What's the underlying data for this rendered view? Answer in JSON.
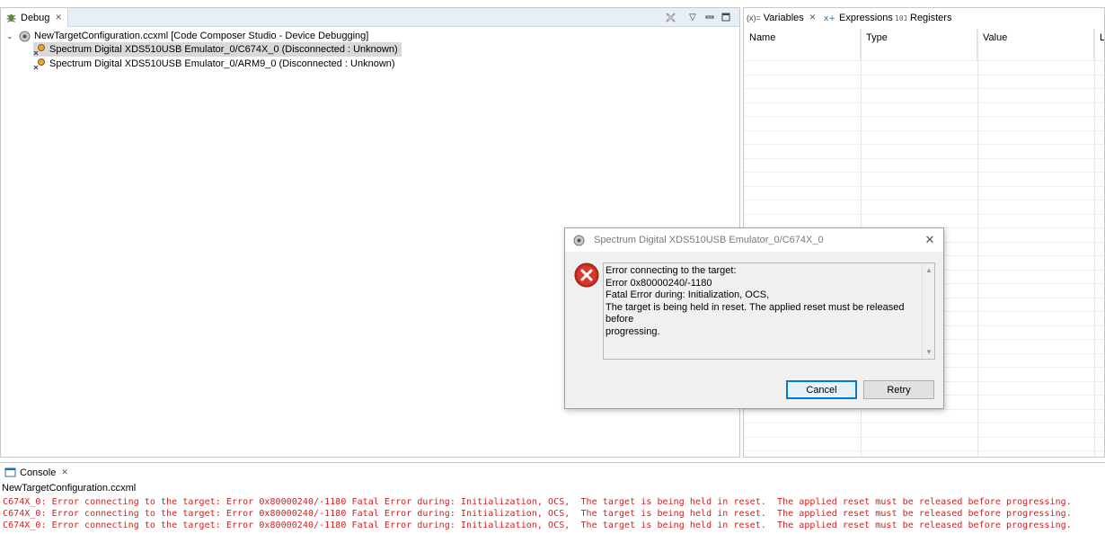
{
  "debug_view": {
    "tab_label": "Debug",
    "tree": {
      "root": "NewTargetConfiguration.ccxml [Code Composer Studio - Device Debugging]",
      "children": [
        "Spectrum Digital XDS510USB Emulator_0/C674X_0 (Disconnected : Unknown)",
        "Spectrum Digital XDS510USB Emulator_0/ARM9_0 (Disconnected : Unknown)"
      ]
    }
  },
  "vars_view": {
    "tabs": [
      {
        "prefix": "(x)=",
        "label": "Variables"
      },
      {
        "label": "Expressions"
      },
      {
        "label": "Registers"
      }
    ],
    "columns": [
      "Name",
      "Type",
      "Value",
      "Lo"
    ]
  },
  "dialog": {
    "title": "Spectrum Digital XDS510USB Emulator_0/C674X_0",
    "message_lines": [
      "Error connecting to the target:",
      "Error 0x80000240/-1180",
      "Fatal Error during: Initialization, OCS,",
      "The target is being held in reset.  The applied reset must be released before",
      "progressing."
    ],
    "buttons": {
      "cancel": "Cancel",
      "retry": "Retry"
    }
  },
  "console_view": {
    "tab_label": "Console",
    "name": "NewTargetConfiguration.ccxml",
    "lines": [
      "C674X_0: Error connecting to the target: Error 0x80000240/-1180 Fatal Error during: Initialization, OCS,  The target is being held in reset.  The applied reset must be released before progressing.",
      "C674X_0: Error connecting to the target: Error 0x80000240/-1180 Fatal Error during: Initialization, OCS,  The target is being held in reset.  The applied reset must be released before progressing.",
      "C674X_0: Error connecting to the target: Error 0x80000240/-1180 Fatal Error during: Initialization, OCS,  The target is being held in reset.  The applied reset must be released before progressing."
    ],
    "error_color": "#d32020"
  },
  "colors": {
    "tab_bar": "#e6eef7",
    "selection": "#d9d9d9",
    "default_button_border": "#0078d7",
    "error_icon": "#c42b1c"
  }
}
